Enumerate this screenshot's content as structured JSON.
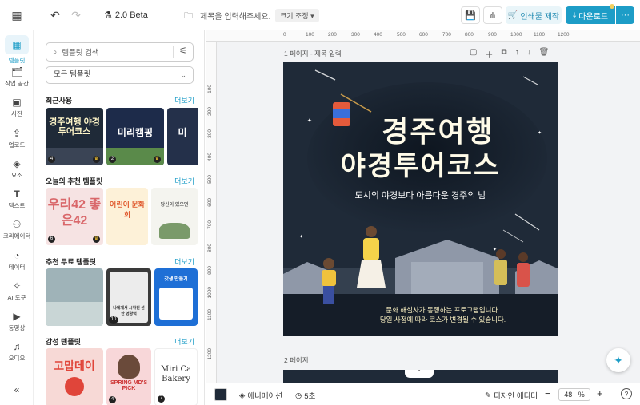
{
  "topbar": {
    "version": "2.0 Beta",
    "doc_title_placeholder": "제목을 입력해주세요.",
    "size_button": "크기 조정",
    "print_button": "인쇄물 제작",
    "download_button": "다운로드",
    "more_button": "···"
  },
  "leftnav": {
    "items": [
      {
        "label": "템플릿",
        "icon": "template-icon"
      },
      {
        "label": "작업 공간",
        "icon": "folder-icon"
      },
      {
        "label": "사진",
        "icon": "photo-icon"
      },
      {
        "label": "업로드",
        "icon": "upload-icon"
      },
      {
        "label": "요소",
        "icon": "elements-icon"
      },
      {
        "label": "텍스트",
        "icon": "text-icon"
      },
      {
        "label": "크리에이터",
        "icon": "creator-icon"
      },
      {
        "label": "데이터",
        "icon": "data-icon"
      },
      {
        "label": "AI 도구",
        "icon": "ai-icon"
      },
      {
        "label": "동영상",
        "icon": "video-icon"
      },
      {
        "label": "오디오",
        "icon": "audio-icon"
      }
    ],
    "collapse": "«"
  },
  "panel": {
    "search_placeholder": "템플릿 검색",
    "dropdown": "모든 템플릿",
    "more": "더보기",
    "sections": [
      {
        "title": "최근사용",
        "thumbs": [
          {
            "text": "경주여행 야경투어코스",
            "num": "4",
            "bg": "#1f2a38",
            "fg": "#fff6c8"
          },
          {
            "text": "미리캠핑",
            "num": "2",
            "bg": "#1d2b4a",
            "fg": "#ffffff"
          },
          {
            "text": "미",
            "num": "",
            "bg": "#24304a",
            "fg": "#fff"
          }
        ]
      },
      {
        "title": "오늘의 추천 템플릿",
        "thumbs": [
          {
            "text": "우리42 좋은42",
            "num": "6",
            "bg": "#f6e3e3",
            "fg": "#d9676a"
          },
          {
            "text": "어린이 문화회",
            "num": "",
            "bg": "#fdf1d8",
            "fg": "#e05a2f"
          },
          {
            "text": "당신이 있으면",
            "num": "",
            "bg": "#f4f4ef",
            "fg": "#666"
          }
        ]
      },
      {
        "title": "추천 무료 템플릿",
        "thumbs": [
          {
            "text": "",
            "num": "",
            "bg": "#9fb3b8",
            "fg": "#fff"
          },
          {
            "text": "나에게서 시작된 선한 영향력",
            "num": "10",
            "bg": "#ececec",
            "fg": "#333"
          },
          {
            "text": "갓생 만들기",
            "num": "",
            "bg": "#1e6fd6",
            "fg": "#fff"
          }
        ]
      },
      {
        "title": "감성 템플릿",
        "thumbs": [
          {
            "text": "고맙데이",
            "num": "",
            "bg": "#f7d9d6",
            "fg": "#e0453a"
          },
          {
            "text": "SPRING MD'S PICK",
            "num": "4",
            "bg": "#f8d7d9",
            "fg": "#c33"
          },
          {
            "text": "Miri Ca Bakery",
            "num": "7",
            "bg": "#ffffff",
            "fg": "#333"
          }
        ]
      }
    ]
  },
  "canvas": {
    "page1_label": "1 페이지 - 제목 입력",
    "page2_label": "2 페이지",
    "ruler_top": [
      "0",
      "100",
      "200",
      "300",
      "400",
      "500",
      "600",
      "700",
      "800",
      "900",
      "1000",
      "1100",
      "1200"
    ],
    "ruler_left": [
      "100",
      "200",
      "300",
      "400",
      "500",
      "600",
      "700",
      "800",
      "900",
      "1000",
      "1100",
      "1200"
    ],
    "design": {
      "title_line1": "경주여행",
      "title_line2": "야경투어코스",
      "subtitle": "도시의 야경보다 아름다운 경주의 밤",
      "note_line1": "문화 해설사가 동행하는 프로그램입니다.",
      "note_line2": "당일 사정에 따라 코스가 변경될 수 있습니다."
    }
  },
  "bottombar": {
    "animation": "애니메이션",
    "duration": "5초",
    "design_editor": "디자인 에디터",
    "zoom": "48",
    "zoom_unit": "%",
    "minus": "−",
    "plus": "+",
    "help": "?"
  },
  "colors": {
    "accent": "#1d9dc7",
    "design_bg": "#1f2a38"
  }
}
